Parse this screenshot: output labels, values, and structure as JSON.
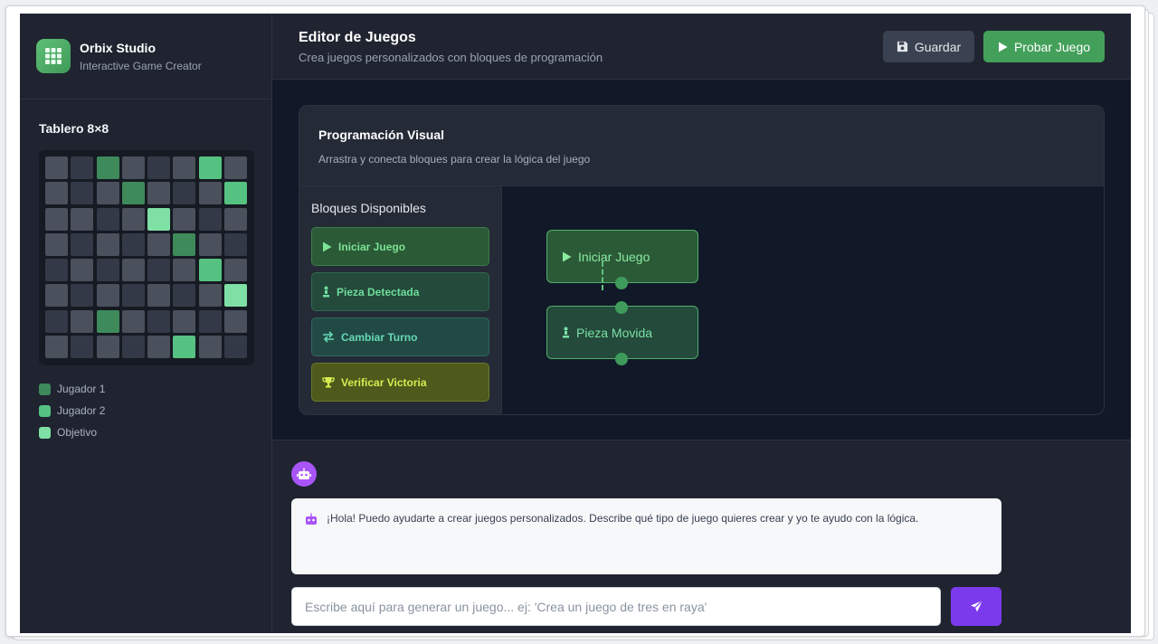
{
  "brand": {
    "name": "Orbix Studio",
    "subtitle": "Interactive Game Creator"
  },
  "sidebar": {
    "board_title": "Tablero 8×8",
    "board_cells": [
      "light",
      "dark",
      "p1",
      "light",
      "dark",
      "light",
      "p2",
      "light",
      "light",
      "dark",
      "light",
      "p1",
      "light",
      "dark",
      "light",
      "p2",
      "light",
      "light",
      "dark",
      "light",
      "obj",
      "light",
      "dark",
      "light",
      "light",
      "dark",
      "light",
      "dark",
      "light",
      "p1",
      "light",
      "dark",
      "dark",
      "light",
      "dark",
      "light",
      "dark",
      "light",
      "p2",
      "light",
      "light",
      "dark",
      "light",
      "dark",
      "light",
      "dark",
      "light",
      "obj",
      "dark",
      "light",
      "p1",
      "light",
      "dark",
      "light",
      "dark",
      "light",
      "light",
      "dark",
      "light",
      "dark",
      "light",
      "p2",
      "light",
      "dark"
    ],
    "legend": [
      {
        "label": "Jugador 1",
        "color": "#3e8a5b"
      },
      {
        "label": "Jugador 2",
        "color": "#56c282"
      },
      {
        "label": "Objetivo",
        "color": "#7fe0a5"
      }
    ]
  },
  "header": {
    "title": "Editor de Juegos",
    "subtitle": "Crea juegos personalizados con bloques de programación",
    "save_label": "Guardar",
    "test_label": "Probar Juego"
  },
  "editor": {
    "title": "Programación Visual",
    "subtitle": "Arrastra y conecta bloques para crear la lógica del juego",
    "palette_title": "Bloques Disponibles",
    "palette": [
      {
        "label": "Iniciar Juego",
        "icon": "play-icon"
      },
      {
        "label": "Pieza Detectada",
        "icon": "chess-pawn-icon"
      },
      {
        "label": "Cambiar Turno",
        "icon": "swap-arrows-icon"
      },
      {
        "label": "Verificar Victoria",
        "icon": "trophy-icon"
      }
    ],
    "canvas_blocks": [
      {
        "label": "Iniciar Juego",
        "icon": "play-icon"
      },
      {
        "label": "Pieza Movida",
        "icon": "chess-pawn-icon"
      }
    ]
  },
  "chat": {
    "bot_message": "¡Hola! Puedo ayudarte a crear juegos personalizados. Describe qué tipo de juego quieres crear y yo te ayudo con la lógica.",
    "input_value": "",
    "input_placeholder": "Escribe aquí para generar un juego... ej: 'Crea un juego de tres en raya'"
  },
  "colors": {
    "accent_green": "#43a05a",
    "accent_purple": "#7c3aed",
    "bot_avatar": "#a855f7"
  }
}
